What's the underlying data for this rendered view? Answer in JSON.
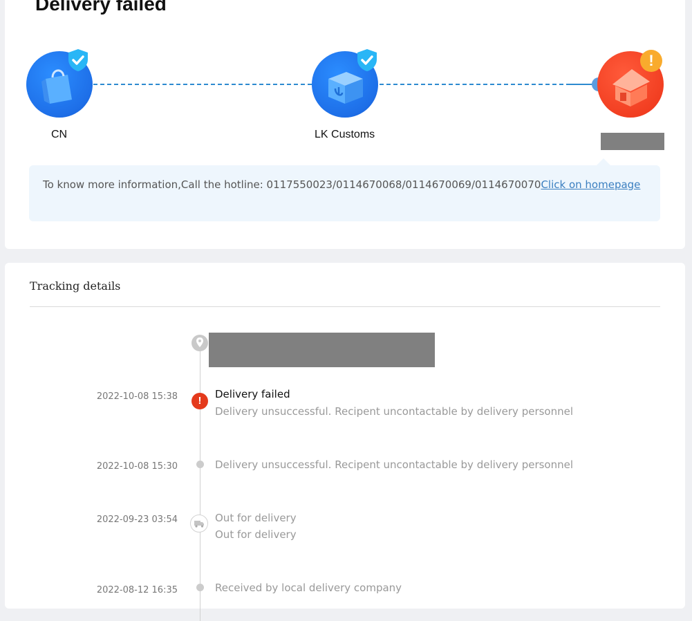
{
  "status": {
    "title": "Delivery failed",
    "steps": [
      {
        "label": "CN",
        "icon": "shopping-bag-icon",
        "state": "completed"
      },
      {
        "label": "LK Customs",
        "icon": "customs-package-icon",
        "state": "completed"
      },
      {
        "label": "",
        "icon": "house-icon",
        "state": "failed"
      }
    ],
    "info": {
      "text": "To know more information,Call the hotline: 0117550023/0114670068/0114670069/0114670070",
      "link": "Click on homepage"
    }
  },
  "tracking": {
    "title": "Tracking details",
    "events": [
      {
        "time": "2022-10-08 15:38",
        "status": "Delivery failed",
        "description": "Delivery unsuccessful. Recipent uncontactable by delivery personnel",
        "icon": "alert-icon"
      },
      {
        "time": "2022-10-08 15:30",
        "status": "",
        "description": "Delivery unsuccessful. Recipent uncontactable by delivery personnel",
        "icon": "dot-icon"
      },
      {
        "time": "2022-09-23 03:54",
        "status": "",
        "description": "Out for delivery",
        "description2": "Out for delivery",
        "icon": "truck-icon"
      },
      {
        "time": "2022-08-12 16:35",
        "status": "",
        "description": "Received by local delivery company",
        "icon": "dot-icon"
      }
    ]
  },
  "colors": {
    "accent_blue": "#1e6fe8",
    "alert_red": "#e43a1c",
    "warning_orange": "#f9ab2d",
    "link": "#3b7fc0",
    "info_bg": "#eef6fd"
  }
}
